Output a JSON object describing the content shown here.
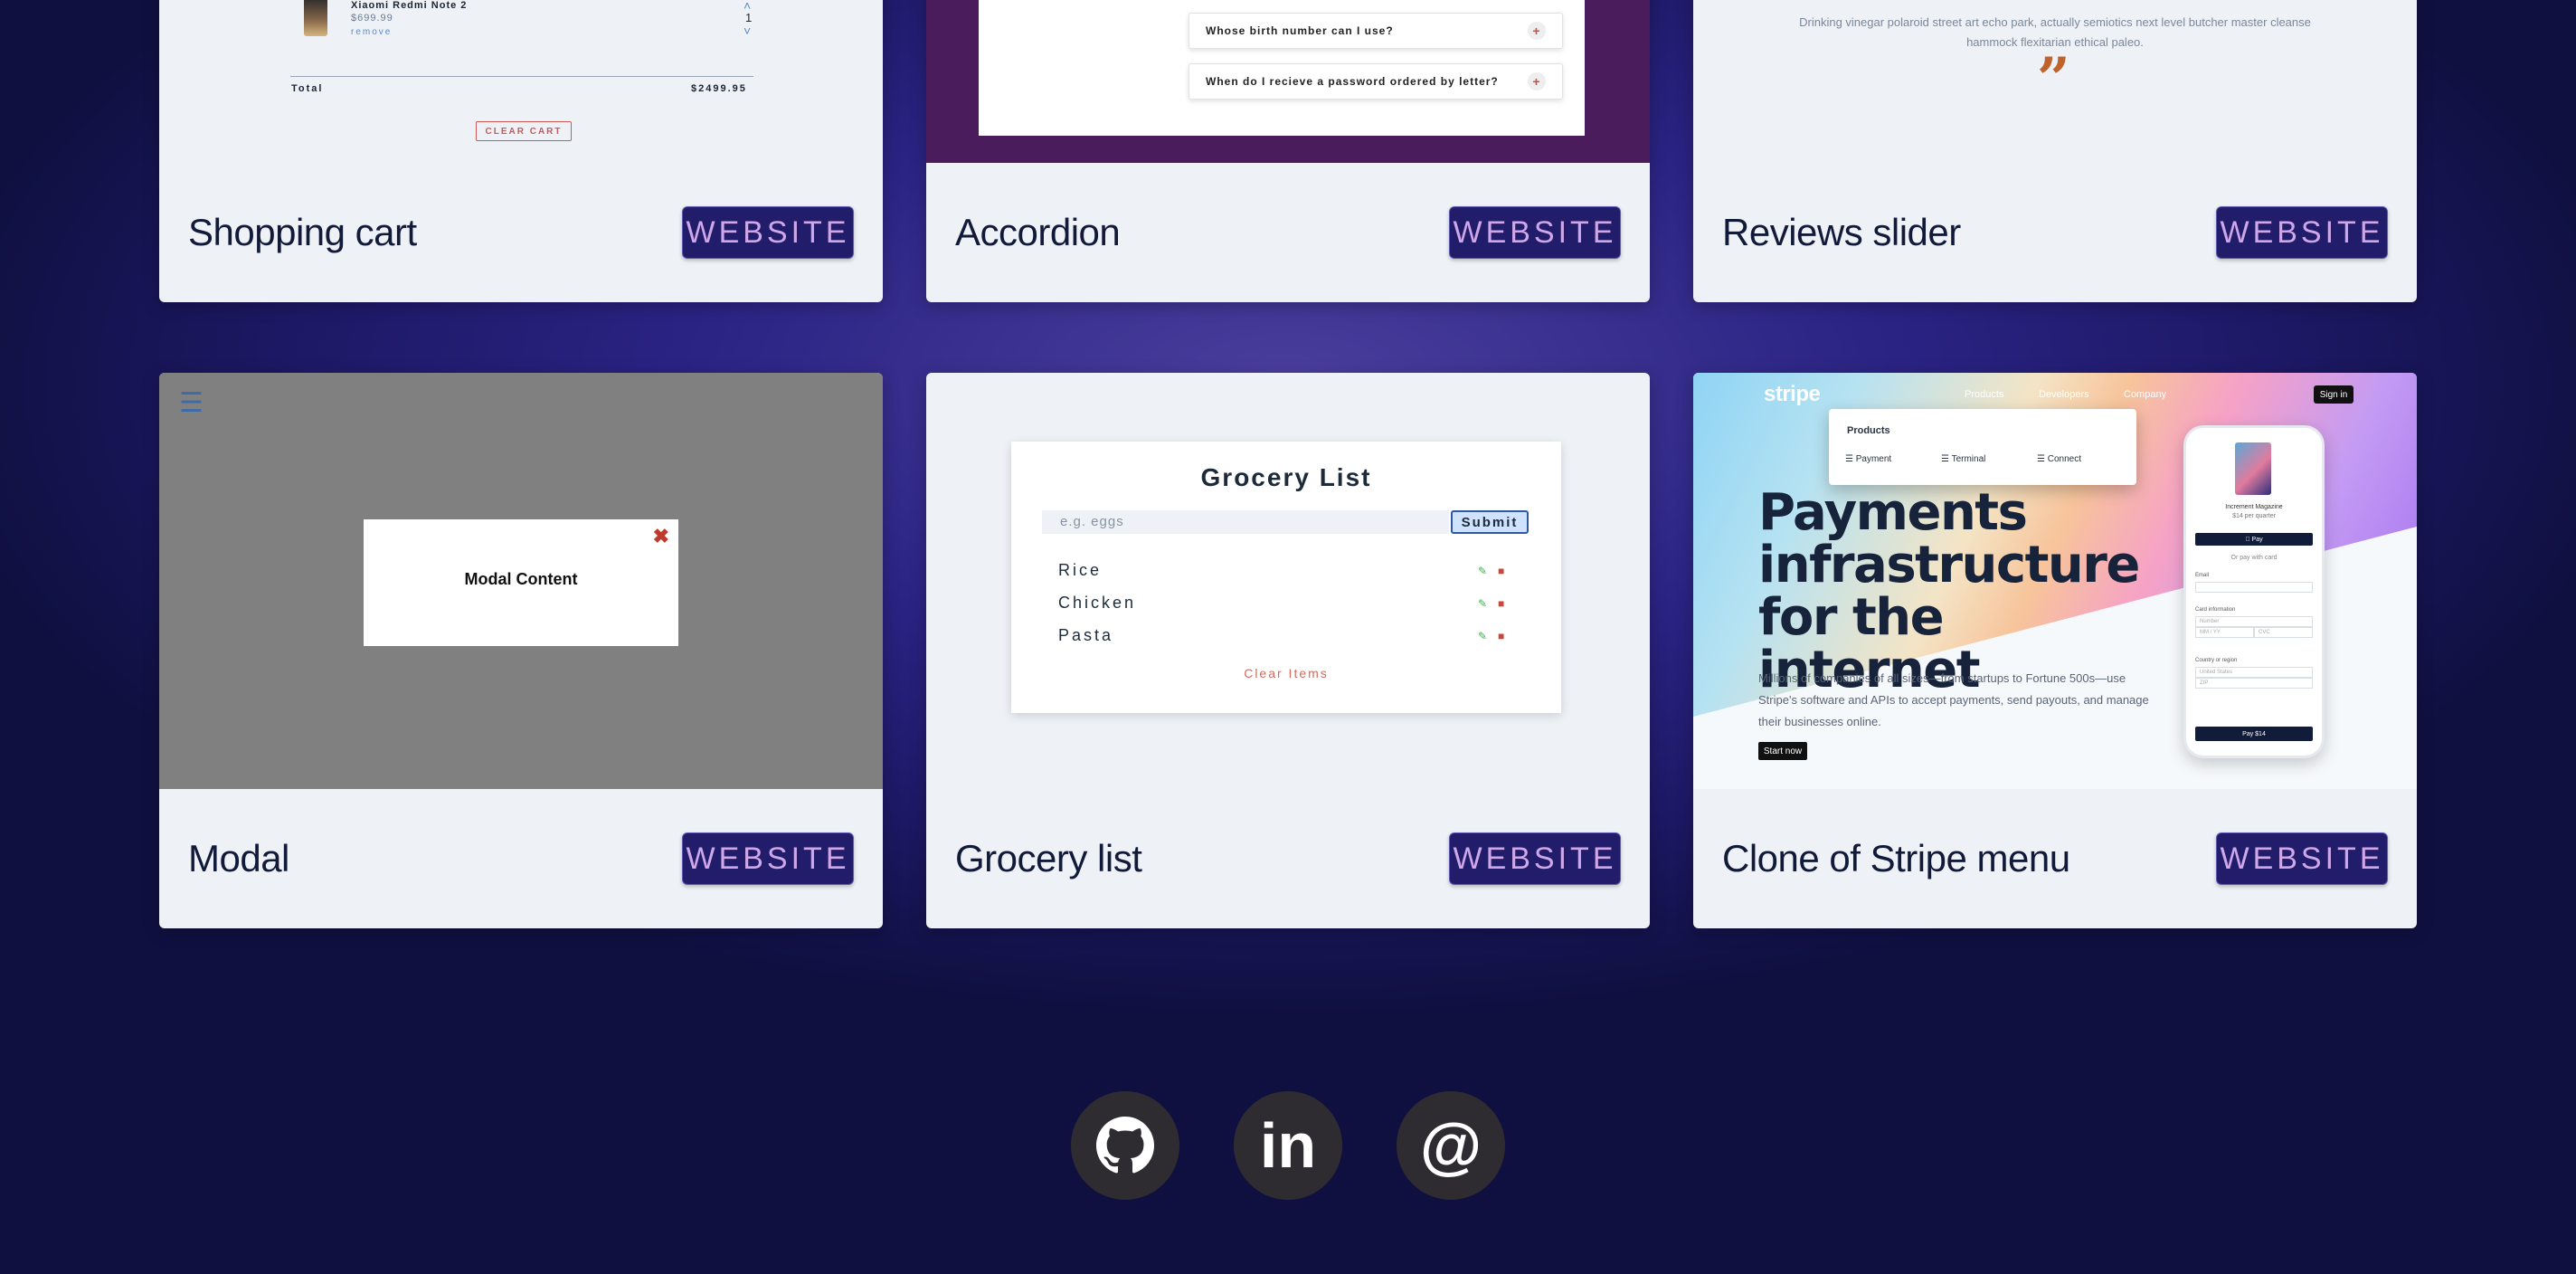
{
  "cards": {
    "shopping_cart": {
      "title": "Shopping cart",
      "button": "WEBSITE",
      "preview": {
        "item_name": "Xiaomi Redmi Note 2",
        "item_price": "$699.99",
        "item_remove": "remove",
        "item_qty": "1",
        "total_label": "Total",
        "total_value": "$2499.95",
        "clear_label": "CLEAR CART"
      }
    },
    "accordion": {
      "title": "Accordion",
      "button": "WEBSITE",
      "preview": {
        "questions": [
          "Whose birth number can I use?",
          "When do I recieve a password ordered by letter?"
        ],
        "plus": "+"
      }
    },
    "reviews": {
      "title": "Reviews slider",
      "button": "WEBSITE",
      "preview": {
        "text": "Drinking vinegar polaroid street art echo park, actually semiotics next level butcher master cleanse hammock flexitarian ethical paleo.",
        "quote_glyph": "”"
      }
    },
    "modal": {
      "title": "Modal",
      "button": "WEBSITE",
      "preview": {
        "menu_glyph": "☰",
        "close_glyph": "✖",
        "content": "Modal Content"
      }
    },
    "grocery": {
      "title": "Grocery list",
      "button": "WEBSITE",
      "preview": {
        "heading": "Grocery List",
        "input_placeholder": "e.g. eggs",
        "submit": "Submit",
        "items": [
          "Rice",
          "Chicken",
          "Pasta"
        ],
        "clear": "Clear Items"
      }
    },
    "stripe": {
      "title": "Clone of Stripe menu",
      "button": "WEBSITE",
      "preview": {
        "logo": "stripe",
        "nav": [
          "Products",
          "Developers",
          "Company"
        ],
        "signin": "Sign in",
        "menu_heading": "Products",
        "menu_items": [
          "Payment",
          "Terminal",
          "Connect"
        ],
        "headline": "Payments infrastructure for the internet",
        "paragraph": "Millions of companies of all sizes—from startups to Fortune 500s—use Stripe's software and APIs to accept payments, send payouts, and manage their businesses online.",
        "start": "Start now",
        "phone": {
          "product": "Increment Magazine",
          "price": "$14 per quarter",
          "apple_pay": " Pay",
          "or": "Or pay with card",
          "email": "Email",
          "card": "Card information",
          "number": "Number",
          "expiry": "MM / YY",
          "cvc": "CVC",
          "country": "Country or region",
          "country_val": "United States",
          "zip": "ZIP",
          "pay": "Pay $14"
        }
      }
    }
  },
  "social": {
    "github": "github-icon",
    "linkedin_glyph": "in",
    "email_glyph": "@"
  }
}
